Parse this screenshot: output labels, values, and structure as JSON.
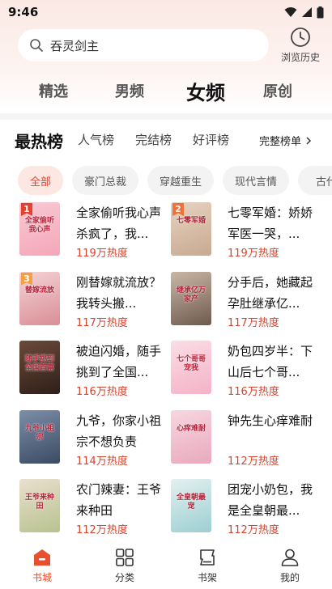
{
  "status": {
    "time": "9:46"
  },
  "search": {
    "placeholder": "吞灵剑主",
    "history_label": "浏览历史"
  },
  "main_tabs": [
    {
      "label": "精选",
      "active": false
    },
    {
      "label": "男频",
      "active": false
    },
    {
      "label": "女频",
      "active": true
    },
    {
      "label": "原创",
      "active": false
    }
  ],
  "rank_tabs": [
    {
      "label": "最热榜",
      "active": true
    },
    {
      "label": "人气榜",
      "active": false
    },
    {
      "label": "完结榜",
      "active": false
    },
    {
      "label": "好评榜",
      "active": false
    }
  ],
  "rank_full_label": "完整榜单",
  "chips": [
    {
      "label": "全部",
      "active": true
    },
    {
      "label": "豪门总裁",
      "active": false
    },
    {
      "label": "穿越重生",
      "active": false
    },
    {
      "label": "现代言情",
      "active": false
    },
    {
      "label": "古代",
      "active": false
    }
  ],
  "books": [
    {
      "rank": "1",
      "title": "全家偷听我心声杀疯了，我...",
      "heat": "119万热度",
      "cover_text": "全家偷听我心声",
      "cover_colors": [
        "#f9c9d3",
        "#f3a7b8"
      ]
    },
    {
      "rank": "2",
      "title": "七零军婚：娇娇军医一哭，...",
      "heat": "119万热度",
      "cover_text": "七零军婚",
      "cover_colors": [
        "#e6d3c2",
        "#c8a990"
      ]
    },
    {
      "rank": "3",
      "title": "刚替嫁就流放？我转头搬...",
      "heat": "117万热度",
      "cover_text": "替嫁流放",
      "cover_colors": [
        "#f4d3d6",
        "#d98e95"
      ]
    },
    {
      "rank": "",
      "title": "分手后，她藏起孕肚继承亿...",
      "heat": "117万热度",
      "cover_text": "继承亿万家产",
      "cover_colors": [
        "#c9b7a6",
        "#6e5a4d"
      ]
    },
    {
      "rank": "",
      "title": "被迫闪婚，随手挑到了全国...",
      "heat": "116万热度",
      "cover_text": "随手挑到全国首富",
      "cover_colors": [
        "#6b4a3a",
        "#2e1f19"
      ]
    },
    {
      "rank": "",
      "title": "奶包四岁半：下山后七个哥...",
      "heat": "116万热度",
      "cover_text": "七个哥哥宠我",
      "cover_colors": [
        "#fbdde6",
        "#f4b2c6"
      ]
    },
    {
      "rank": "",
      "title": "九爷，你家小祖宗不想负责",
      "heat": "114万热度",
      "cover_text": "九爷小祖宗",
      "cover_colors": [
        "#7b8ea8",
        "#3c4b63"
      ]
    },
    {
      "rank": "",
      "title": "钟先生心痒难耐",
      "heat": "112万热度",
      "cover_text": "心痒难耐",
      "cover_colors": [
        "#f7d7e0",
        "#e9a9bd"
      ]
    },
    {
      "rank": "",
      "title": "农门辣妻：王爷来种田",
      "heat": "112万热度",
      "cover_text": "王爷来种田",
      "cover_colors": [
        "#eadfcf",
        "#b7c38f"
      ]
    },
    {
      "rank": "",
      "title": "团宠小奶包，我是全皇朝最...",
      "heat": "112万热度",
      "cover_text": "全皇朝最宠",
      "cover_colors": [
        "#e4f0ef",
        "#9ccfd3"
      ]
    }
  ],
  "bottom_nav": [
    {
      "label": "书城",
      "active": true
    },
    {
      "label": "分类",
      "active": false
    },
    {
      "label": "书架",
      "active": false
    },
    {
      "label": "我的",
      "active": false
    }
  ],
  "colors": {
    "accent": "#e8502f",
    "heat": "#d5452f",
    "rank1": "#e8402f",
    "rank2": "#f0703a",
    "rank3": "#f3a040"
  }
}
